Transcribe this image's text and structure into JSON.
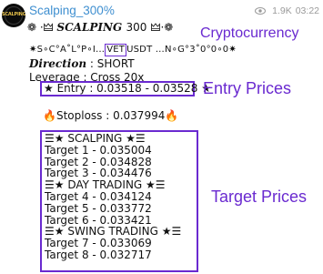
{
  "header": {
    "channel_name": "Scalping_300%",
    "views": "1.9K",
    "time": "03:22",
    "avatar_text": "SCALPING"
  },
  "post": {
    "headline_prefix": "❁ ·🜲 ",
    "headline_stylized": "𝑺𝑪𝑨𝑳𝑷𝑰𝑵𝑮",
    "headline_number": "300",
    "headline_suffix": "🜲·❁",
    "pair_prefix": "✷S∘C°A˚L°P∘I…",
    "pair_symbol": "VET",
    "pair_suffix": "USDT …N∘G°3˚0°0∘0✷",
    "direction_label": "𝑫𝒊𝒓𝒆𝒄𝒕𝒊𝒐𝒏",
    "direction_value": " : SHORT",
    "leverage": "Leverage : Cross 20x",
    "entry": "★ Entry : 0.03518 - 0.03528 ★",
    "stoploss_icon_left": "🔥",
    "stoploss_text": "Stoploss : 0.037994",
    "stoploss_icon_right": "🔥",
    "targets_lines": [
      "☰★ SCALPING ★☰",
      "Target 1 - 0.035004",
      "Target 2 - 0.034828",
      "Target 3 - 0.034476",
      "☰★ DAY TRADING ★☰",
      "Target 4 - 0.034124",
      "Target 5 - 0.033772",
      "Target 6 - 0.033421",
      "☰★ SWING TRADING ★☰",
      "Target 7 - 0.033069",
      "Target 8 - 0.032717"
    ]
  },
  "annotations": {
    "cryptocurrency": "Cryptocurrency",
    "entry_prices": "Entry Prices",
    "target_prices": "Target Prices"
  },
  "colors": {
    "channel_link": "#3f8fd0",
    "annotation_purple": "#6a2ad0",
    "meta_gray": "#9a9a9a"
  }
}
